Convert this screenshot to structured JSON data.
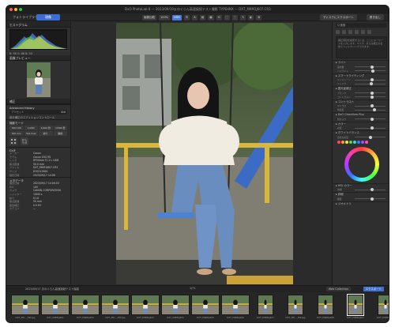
{
  "window": {
    "app_name": "DxO PhotoLab",
    "title": "DxO PhotoLab 8 — 2023/09/19まゆぐらん高速接続テスト撮影 TYPEHNX — DXT_M9M1J607.CR3"
  },
  "tabs": [
    {
      "label": "フォトライブラリ",
      "active": false
    },
    {
      "label": "現像",
      "active": true
    }
  ],
  "toolbar": {
    "items": [
      "画像比較",
      "100%",
      "HDR",
      "☰",
      "A",
      "▤",
      "▦",
      "⟲",
      "⬚",
      "⬚",
      "✎",
      "◐",
      "⚙"
    ],
    "export_label": "ディスクにエクスポート",
    "export2_label": "書き出し"
  },
  "left_panel": {
    "histogram_title": "ヒストグラム",
    "histogram_tabs": [
      "RGB",
      "R",
      "G",
      "B",
      "L"
    ],
    "histogram_readout": "R: 58  G: 66  B: 53",
    "navigator_title": "画像プレビュー",
    "moire_title": "補正",
    "advanced_history_label": "Advanced History",
    "preset_label": "プリセット",
    "preset_value": "Ctrl",
    "preset_note": "部分補正のエディションコントロール",
    "camera_section_title": "撮影モード",
    "iso_buttons": [
      "ISO 100",
      "1/200",
      "1/400 秒",
      "1/500 秒",
      "ISO min",
      "ISO max",
      "絞り",
      "開放"
    ],
    "exif_title": "EXIF",
    "exif": [
      {
        "k": "メーカー",
        "v": "Canon"
      },
      {
        "k": "モデル",
        "v": "Canon EOS R5"
      },
      {
        "k": "レンズ",
        "v": "RF50mm F1.2 L USM"
      },
      {
        "k": "焦点距離",
        "v": "50.0 mm"
      },
      {
        "k": "ファイル",
        "v": "DXT_M9M1J607.CR3"
      },
      {
        "k": "サイズ",
        "v": "8192×5464"
      },
      {
        "k": "撮影日時",
        "v": "2023/09/17 14:06"
      }
    ],
    "metadata_title": "メタデータ",
    "metadata": [
      {
        "k": "撮影日時",
        "v": "2023/09/17  14:06:03"
      },
      {
        "k": "ISO",
        "v": "100"
      },
      {
        "k": "カメラ",
        "v": "CANON CORPORATION"
      },
      {
        "k": "シャッター",
        "v": "1/640 s"
      },
      {
        "k": "絞り",
        "v": "f/1.8"
      },
      {
        "k": "焦点距離",
        "v": "50 mm"
      },
      {
        "k": "露出補正",
        "v": "0.0 EV"
      },
      {
        "k": "カテゴリ",
        "v": "—"
      }
    ]
  },
  "right_panel": {
    "search_placeholder": "Q 検索",
    "info_text": "補正項目を検索するには、ここにキーワードを入力します。マスク、または補正の名前でフィルタリングできます。",
    "sections": [
      "ライト",
      "スマートライティング",
      "露光量補正",
      "コントラスト",
      "DxO ClearView Plus",
      "カラー",
      "ホワイトバランス",
      "HSL カラー",
      "詳細",
      "ジオメトリ"
    ],
    "sliders": [
      {
        "label": "露光量",
        "pos": 0.5
      },
      {
        "label": "ハイライト",
        "pos": 0.55
      },
      {
        "label": "ミッドトーン",
        "pos": 0.5
      },
      {
        "label": "シャドウ",
        "pos": 0.48
      },
      {
        "label": "ブラック",
        "pos": 0.5
      },
      {
        "label": "コントラスト",
        "pos": 0.52
      },
      {
        "label": "マイクロ",
        "pos": 0.5
      },
      {
        "label": "色温度",
        "pos": 0.6
      },
      {
        "label": "色かぶり",
        "pos": 0.5
      },
      {
        "label": "彩度",
        "pos": 0.5
      },
      {
        "label": "自然な彩度",
        "pos": 0.45
      },
      {
        "label": "色相",
        "pos": 0.5
      },
      {
        "label": "輝度",
        "pos": 0.5
      }
    ],
    "swatch_colors": [
      "#ff4a4a",
      "#ff9b3b",
      "#f5e342",
      "#4ed45a",
      "#3bd6d6",
      "#3b78ff",
      "#a64bff",
      "#ff4bc2"
    ]
  },
  "filmstrip": {
    "path_label": "2023/09/17 まゆぐらん高速接続テスト撮影",
    "count_label": "1/71",
    "filter_label": "Web Collection",
    "filter2_label": "エクスポート",
    "items": [
      {
        "label": "DXT_M9…_EW.jpg",
        "portrait": false,
        "selected": false
      },
      {
        "label": "DXT_M9M1J601",
        "portrait": false,
        "selected": false
      },
      {
        "label": "DXT_M9M1J602",
        "portrait": false,
        "selected": false
      },
      {
        "label": "DXT_M9…_EW.jpg",
        "portrait": false,
        "selected": false
      },
      {
        "label": "DXT_M9M1J603",
        "portrait": false,
        "selected": false
      },
      {
        "label": "DXT_M9M1J604",
        "portrait": false,
        "selected": false
      },
      {
        "label": "DXT_M9M1J605",
        "portrait": false,
        "selected": false
      },
      {
        "label": "DXT_M9M1J606",
        "portrait": false,
        "selected": false
      },
      {
        "label": "DXT_M9M1J607",
        "portrait": true,
        "selected": false
      },
      {
        "label": "DXT_M9…_EW.jpg",
        "portrait": true,
        "selected": false
      },
      {
        "label": "DXT_M9M1J608",
        "portrait": true,
        "selected": false
      },
      {
        "label": "DXT_M9M1J607",
        "portrait": true,
        "selected": true
      },
      {
        "label": "DXT_M9M1J609",
        "portrait": true,
        "selected": false
      }
    ]
  },
  "colors": {
    "accent": "#3d6fd1",
    "panel_bg": "#2f2f2f",
    "canvas_bg": "#2b2b2b"
  }
}
